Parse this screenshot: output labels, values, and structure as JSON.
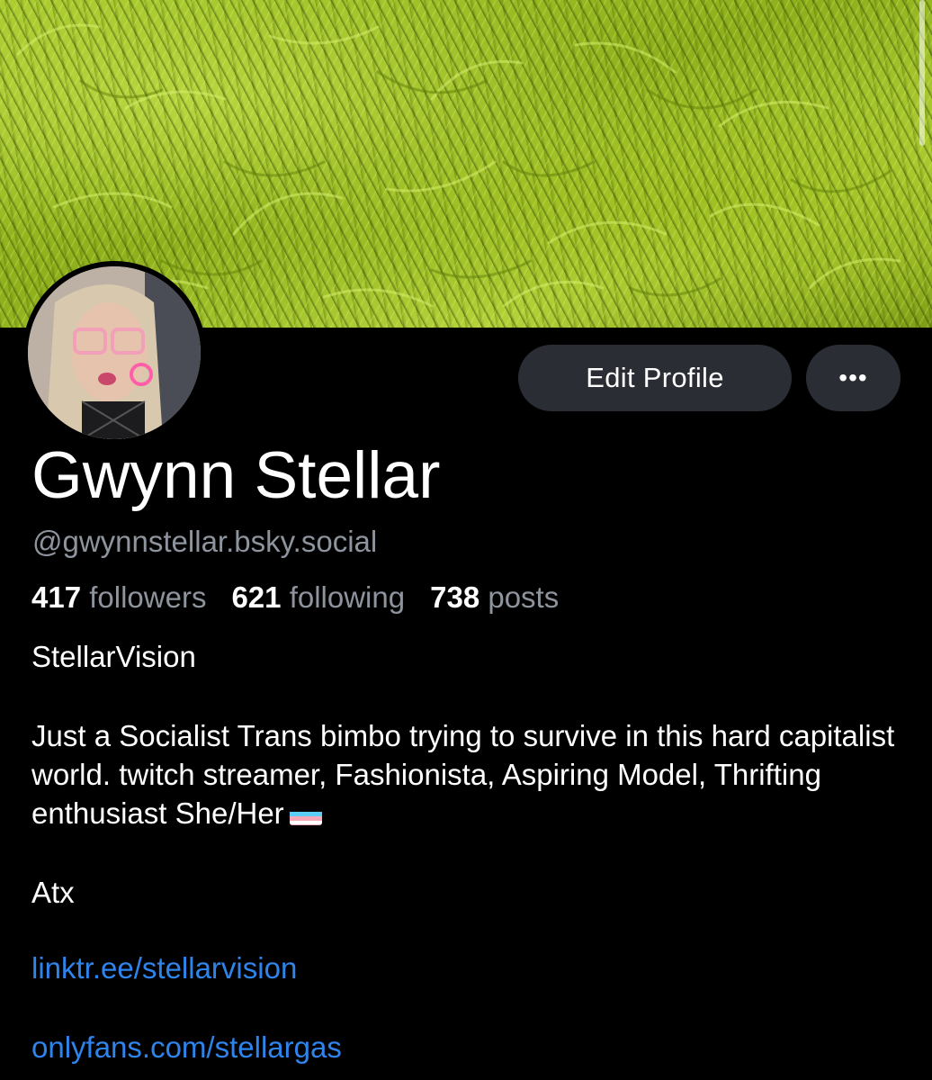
{
  "profile": {
    "name": "Gwynn Stellar",
    "handle": "@gwynnstellar.bsky.social",
    "followers_count": "417",
    "followers_label": "followers",
    "following_count": "621",
    "following_label": "following",
    "posts_count": "738",
    "posts_label": "posts",
    "display_tagline": "StellarVision",
    "bio": "Just a Socialist Trans bimbo trying to survive in this hard capitalist world. twitch streamer, Fashionista, Aspiring Model, Thrifting enthusiast She/Her",
    "location": "Atx",
    "links": [
      "linktr.ee/stellarvision",
      "onlyfans.com/stellargas"
    ]
  },
  "actions": {
    "edit_label": "Edit Profile",
    "more_label": "•••"
  },
  "icons": {
    "more": "more-horizontal-icon",
    "flag": "trans-flag-emoji"
  },
  "colors": {
    "background": "#000000",
    "button_bg": "#2a2d33",
    "secondary_text": "#8e949d",
    "link": "#2f84ec",
    "banner_green": "#a8c92c"
  }
}
